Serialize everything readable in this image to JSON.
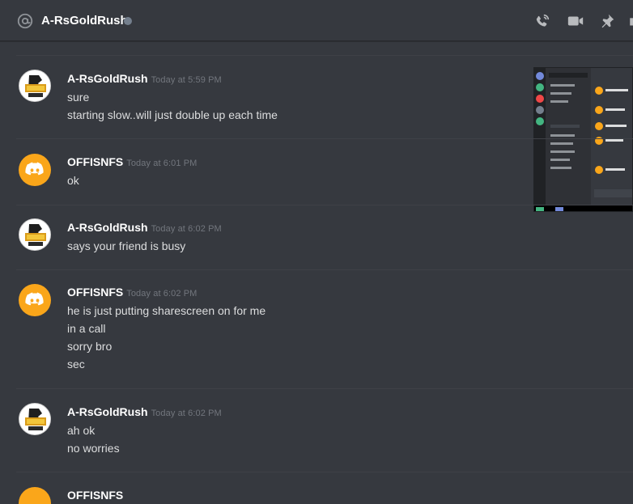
{
  "header": {
    "channel_name": "A-RsGoldRush",
    "status_color": "#747f8d",
    "icons": [
      "at-icon",
      "call-icon",
      "video-icon",
      "pin-icon",
      "more-icon"
    ]
  },
  "messages": [
    {
      "author": "A-RsGoldRush",
      "timestamp": "Today at 5:59 PM",
      "avatar": "rs-gold-logo",
      "lines": [
        "sure",
        "starting slow..will just double up each time"
      ]
    },
    {
      "author": "OFFISNFS",
      "timestamp": "Today at 6:01 PM",
      "avatar": "discord-default-orange",
      "lines": [
        "ok"
      ]
    },
    {
      "author": "A-RsGoldRush",
      "timestamp": "Today at 6:02 PM",
      "avatar": "rs-gold-logo",
      "lines": [
        "says your friend is busy"
      ]
    },
    {
      "author": "OFFISNFS",
      "timestamp": "Today at 6:02 PM",
      "avatar": "discord-default-orange",
      "lines": [
        "he is just putting sharescreen on for me",
        "in a call",
        "sorry bro",
        "sec"
      ]
    },
    {
      "author": "A-RsGoldRush",
      "timestamp": "Today at 6:02 PM",
      "avatar": "rs-gold-logo",
      "lines": [
        "ah ok",
        "no worries"
      ]
    },
    {
      "author": "OFFISNFS",
      "timestamp": "",
      "avatar": "discord-default-orange",
      "lines": []
    }
  ],
  "colors": {
    "background": "#36393f",
    "text": "#dcddde",
    "username": "#ffffff",
    "timestamp": "#72767d",
    "discord_avatar": "#faa61a"
  }
}
